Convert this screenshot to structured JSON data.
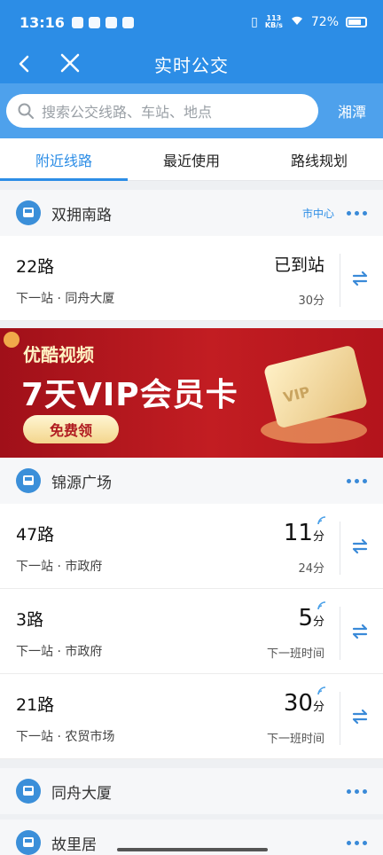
{
  "status_bar": {
    "time": "13:16",
    "net_speed_value": "113",
    "net_speed_unit": "KB/s",
    "battery": "72%"
  },
  "header": {
    "title": "实时公交",
    "back_icon": "back-arrow-icon",
    "close_icon": "close-icon"
  },
  "search": {
    "placeholder": "搜索公交线路、车站、地点",
    "city": "湘潭"
  },
  "tabs": [
    {
      "label": "附近线路",
      "active": true
    },
    {
      "label": "最近使用",
      "active": false
    },
    {
      "label": "路线规划",
      "active": false
    }
  ],
  "stations": [
    {
      "name": "双拥南路",
      "tag": "市中心",
      "routes": [
        {
          "name": "22路",
          "next": "下一站 · 同舟大厦",
          "eta_main": "已到站",
          "eta_unit": "",
          "sub": "30分",
          "live": false
        }
      ]
    },
    {
      "name": "锦源广场",
      "tag": "",
      "routes": [
        {
          "name": "47路",
          "next": "下一站 · 市政府",
          "eta_main": "11",
          "eta_unit": "分",
          "sub": "24分",
          "live": true
        },
        {
          "name": "3路",
          "next": "下一站 · 市政府",
          "eta_main": "5",
          "eta_unit": "分",
          "sub": "下一班时间",
          "live": true
        },
        {
          "name": "21路",
          "next": "下一站 · 农贸市场",
          "eta_main": "30",
          "eta_unit": "分",
          "sub": "下一班时间",
          "live": true
        }
      ]
    },
    {
      "name": "同舟大厦",
      "tag": "",
      "routes": []
    },
    {
      "name": "故里居",
      "tag": "",
      "routes": []
    }
  ],
  "banner": {
    "brand": "优酷视频",
    "headline": "7天VIP会员卡",
    "button": "免费领",
    "card_text": "VIP"
  },
  "colors": {
    "primary": "#2c8de6",
    "banner_red": "#c21d22"
  }
}
